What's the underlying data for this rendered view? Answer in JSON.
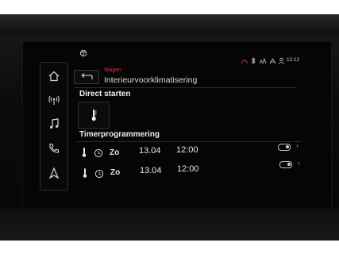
{
  "status": {
    "time": "12:12"
  },
  "header": {
    "breadcrumb": "Wagen",
    "title": "Interieurvoorklimatisering"
  },
  "sections": {
    "direct_start": "Direct starten",
    "timer": "Timerprogrammering"
  },
  "timers": [
    {
      "day": "Zo",
      "date": "13.04",
      "time": "12:00"
    },
    {
      "day": "Zo",
      "date": "13.04",
      "time": "12:00"
    }
  ],
  "sidebar": {
    "items": [
      {
        "icon": "home-icon"
      },
      {
        "icon": "radio-icon"
      },
      {
        "icon": "music-icon"
      },
      {
        "icon": "phone-icon"
      },
      {
        "icon": "navigation-icon"
      }
    ]
  },
  "colors": {
    "accent": "#c43a3a",
    "text": "#e8e8e8",
    "background": "#050505"
  }
}
